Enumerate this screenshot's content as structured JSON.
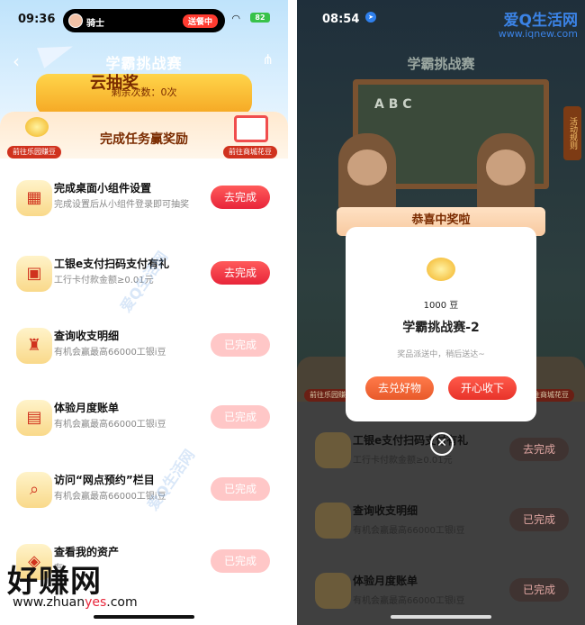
{
  "left": {
    "status": {
      "time": "09:36",
      "user_name": "骑士",
      "live_pill": "送餐中",
      "battery": "82"
    },
    "nav": {
      "title": "学霸挑战赛"
    },
    "banner": {
      "big_text": "云抽奖",
      "remaining": "剩余次数：0次"
    },
    "card": {
      "title": "完成任务赢奖励",
      "tag_left": "前往乐园赚豆",
      "tag_right": "前往商城花豆"
    },
    "tasks": [
      {
        "title": "完成桌面小组件设置",
        "sub": "完成设置后从小组件登录即可抽奖",
        "button": "去完成",
        "done": false
      },
      {
        "title": "工银e支付扫码支付有礼",
        "sub": "工行卡付款金额≥0.01元",
        "button": "去完成",
        "done": false
      },
      {
        "title": "查询收支明细",
        "sub": "有机会赢最高66000工银i豆",
        "button": "已完成",
        "done": true
      },
      {
        "title": "体验月度账单",
        "sub": "有机会赢最高66000工银i豆",
        "button": "已完成",
        "done": true
      },
      {
        "title": "访问“网点预约”栏目",
        "sub": "有机会赢最高66000工银i豆",
        "button": "已完成",
        "done": true
      },
      {
        "title": "查看我的资产",
        "sub": "有",
        "button": "已完成",
        "done": true
      }
    ],
    "watermark_brand": "好赚网",
    "watermark_url_a": "www.zhuan",
    "watermark_url_b": "yes",
    "watermark_url_c": ".com"
  },
  "right": {
    "status": {
      "time": "08:54"
    },
    "site_brand": "爱Q生活网",
    "site_url": "www.iqnew.com",
    "nav": {
      "title": "学霸挑战赛"
    },
    "board_text": "A B C",
    "activity_badge": "活动规则",
    "card": {
      "tag_left": "前往乐园赚豆",
      "tag_right": "前往商城花豆"
    },
    "modal": {
      "title": "恭喜中奖啦",
      "amount": "1000 豆",
      "prize_name": "学霸挑战赛-2",
      "note": "奖品派送中，稍后送达~",
      "btn_left": "去兑好物",
      "btn_right": "开心收下"
    },
    "tasks": [
      {
        "title": "工银e支付扫码支付有礼",
        "sub": "工行卡付款金额≥0.01元",
        "button": "去完成"
      },
      {
        "title": "查询收支明细",
        "sub": "有机会赢最高66000工银i豆",
        "button": "已完成"
      },
      {
        "title": "体验月度账单",
        "sub": "有机会赢最高66000工银i豆",
        "button": "已完成"
      }
    ]
  }
}
